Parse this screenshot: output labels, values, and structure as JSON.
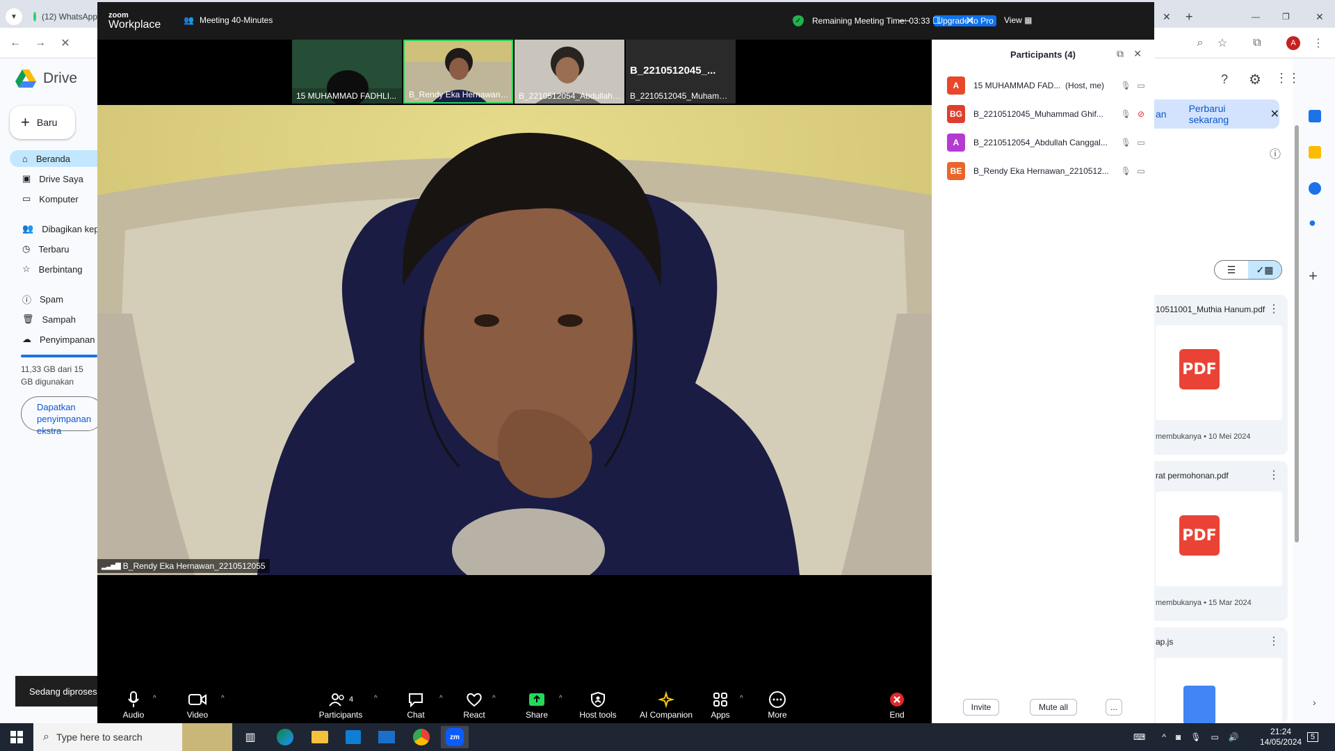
{
  "browser": {
    "tab_label": "(12) WhatsApp",
    "profile_initial": "A"
  },
  "drive": {
    "logo_text": "Drive",
    "new_button": "Baru",
    "nav": [
      {
        "label": "Beranda"
      },
      {
        "label": "Drive Saya"
      },
      {
        "label": "Komputer"
      },
      {
        "label": "Dibagikan kepada saya"
      },
      {
        "label": "Terbaru"
      },
      {
        "label": "Berbintang"
      },
      {
        "label": "Spam"
      },
      {
        "label": "Sampah"
      },
      {
        "label": "Penyimpanan"
      }
    ],
    "storage_text": "11,33 GB dari 15 GB digunakan",
    "storage_button": "Dapatkan penyimpanan ekstra",
    "toast": "Sedang diproses",
    "banner_left": "an",
    "banner_action": "Perbarui sekarang",
    "files": [
      {
        "title": "10511001_Muthia Hanum.pdf",
        "meta": "membukanya • 10 Mei 2024",
        "type": "PDF"
      },
      {
        "title": "rat permohonan.pdf",
        "meta": "membukanya • 15 Mar 2024",
        "type": "PDF"
      },
      {
        "title": "ap.js",
        "meta": "",
        "type": "JS"
      }
    ]
  },
  "zoom": {
    "logo_top": "zoom",
    "logo_bottom": "Workplace",
    "meeting_title": "Meeting 40-Minutes",
    "remaining_label": "Remaining Meeting Time: 03:33",
    "upgrade_label": "Upgrade to Pro",
    "view_label": "View",
    "thumbnails": [
      {
        "name": "15 MUHAMMAD FADHLI..."
      },
      {
        "name": "B_Rendy Eka Hernawan_..."
      },
      {
        "name": "B_2210512054_Abdullah ..."
      },
      {
        "name": "B_2210512045_Muhamm...",
        "big_label": "B_2210512045_..."
      }
    ],
    "active_speaker": "B_Rendy Eka Hernawan_2210512055",
    "participants_panel": {
      "title": "Participants (4)",
      "participants": [
        {
          "initials": "A",
          "name": "15 MUHAMMAD FAD...",
          "role": "(Host, me)",
          "color": "#e8472a"
        },
        {
          "initials": "BG",
          "name": "B_2210512045_Muhammad Ghif...",
          "role": "",
          "color": "#e03e2d"
        },
        {
          "initials": "A",
          "name": "B_2210512054_Abdullah Canggal...",
          "role": "",
          "color": "#b43ad1"
        },
        {
          "initials": "BE",
          "name": "B_Rendy Eka Hernawan_2210512...",
          "role": "",
          "color": "#e8662a"
        }
      ],
      "invite": "Invite",
      "mute_all": "Mute all",
      "more": "..."
    },
    "toolbar": {
      "audio": "Audio",
      "video": "Video",
      "participants": "Participants",
      "participants_count": "4",
      "chat": "Chat",
      "react": "React",
      "share": "Share",
      "host_tools": "Host tools",
      "ai_companion": "AI Companion",
      "apps": "Apps",
      "more": "More",
      "end": "End"
    }
  },
  "taskbar": {
    "search_placeholder": "Type here to search",
    "time": "21:24",
    "date": "14/05/2024",
    "notifications": "5"
  }
}
